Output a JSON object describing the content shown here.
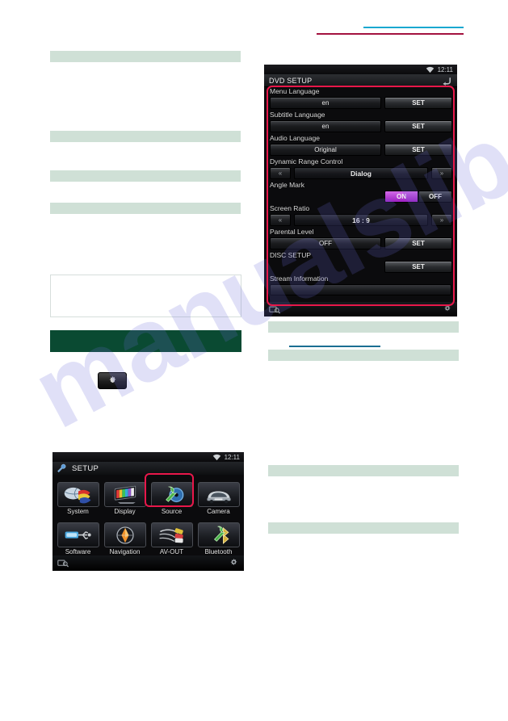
{
  "page": {
    "watermark_text": "manualslib"
  },
  "dvd_setup": {
    "screen_title": "DVD SETUP",
    "clock": "12:11",
    "back_icon": "back-arrow-icon",
    "wifi_icon": "wifi-icon",
    "bottom_left_icon": "disc-search-icon",
    "bottom_right_icon": "gear-icon",
    "rows": [
      {
        "label": "Menu Language",
        "kind": "value_set",
        "value": "en",
        "button": "SET"
      },
      {
        "label": "Subtitle Language",
        "kind": "value_set",
        "value": "en",
        "button": "SET"
      },
      {
        "label": "Audio Language",
        "kind": "value_set",
        "value": "Original",
        "button": "SET"
      },
      {
        "label": "Dynamic Range Control",
        "kind": "stepper",
        "value": "Dialog",
        "prev": "«",
        "next": "»"
      },
      {
        "label": "Angle Mark",
        "kind": "toggle",
        "on_label": "ON",
        "off_label": "OFF",
        "selected": "ON"
      },
      {
        "label": "Screen Ratio",
        "kind": "stepper",
        "value": "16 : 9",
        "prev": "«",
        "next": "»"
      },
      {
        "label": "Parental Level",
        "kind": "value_set",
        "value": "OFF",
        "button": "SET"
      },
      {
        "label": "DISC SETUP",
        "kind": "set_only",
        "button": "SET"
      },
      {
        "label": "Stream Information",
        "kind": "blank_field"
      }
    ]
  },
  "setup_menu": {
    "screen_title": "SETUP",
    "clock": "12:11",
    "wrench_icon": "wrench-icon",
    "wifi_icon": "wifi-icon",
    "bottom_left_icon": "disc-search-icon",
    "bottom_right_icon": "gear-icon",
    "highlighted_item": "Source",
    "items": [
      {
        "label": "System",
        "icon": "globe-flags-icon"
      },
      {
        "label": "Display",
        "icon": "monitor-colorbars-icon"
      },
      {
        "label": "Source",
        "icon": "disc-wrench-icon"
      },
      {
        "label": "Camera",
        "icon": "car-rear-icon"
      },
      {
        "label": "Software",
        "icon": "usb-icon"
      },
      {
        "label": "Navigation",
        "icon": "compass-icon"
      },
      {
        "label": "AV-OUT",
        "icon": "rca-cables-icon"
      },
      {
        "label": "Bluetooth",
        "icon": "bluetooth-wrench-icon"
      }
    ]
  },
  "body_controls": {
    "gear_button_icon": "gear-icon"
  },
  "colors": {
    "redaction_light": "#cfe0d6",
    "redaction_dark": "#0a4a32",
    "rule_maroon": "#a3123f",
    "rule_cyan": "#1aa8d0",
    "link_underline": "#1a6e92",
    "highlight_red": "#e8174a",
    "toggle_on": "#9b1fc0"
  }
}
